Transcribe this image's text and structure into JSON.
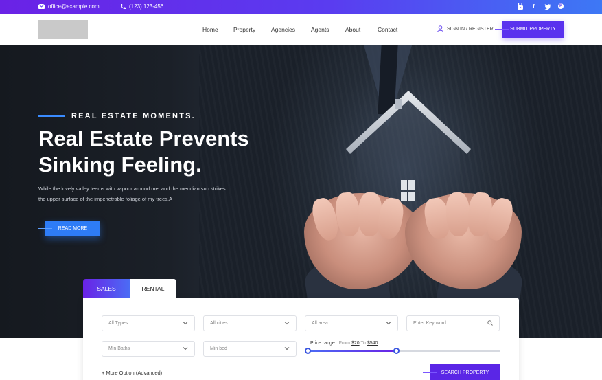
{
  "topbar": {
    "email": "office@example.com",
    "phone": "(123) 123-456",
    "socials": [
      "youtube-icon",
      "facebook-icon",
      "twitter-icon",
      "pinterest-icon"
    ]
  },
  "header": {
    "nav": [
      "Home",
      "Property",
      "Agencies",
      "Agents",
      "About",
      "Contact"
    ],
    "signin_label": "SIGN IN / REGISTER",
    "submit_label": "SUBMIT PROPERTY"
  },
  "hero": {
    "eyebrow": "REAL ESTATE MOMENTS.",
    "title_line1": "Real Estate Prevents",
    "title_line2": "Sinking Feeling.",
    "description_line1": "While the lovely valley teems with vapour around me, and the meridian sun strikes",
    "description_line2": "the upper surface of the impenetrable foliage of my trees.A",
    "read_more_label": "READ MORE"
  },
  "search": {
    "tabs": [
      "SALES",
      "RENTAL"
    ],
    "active_tab": "SALES",
    "types_value": "All Types",
    "cities_value": "All cities",
    "area_value": "All area",
    "keyword_placeholder": "Enter Key word..",
    "baths_value": "Min Baths",
    "bed_value": "Min bed",
    "price_label": "Price range :",
    "price_from_label": "From",
    "price_from": "$20",
    "price_to_label": "To",
    "price_to": "$540",
    "range_fill_fraction": 0.46,
    "more_option_label": "+ More Option (Advanced)",
    "search_button_label": "SEARCH PROPERTY"
  },
  "colors": {
    "accent_purple": "#5a32ee",
    "accent_blue": "#2e7cf6"
  }
}
